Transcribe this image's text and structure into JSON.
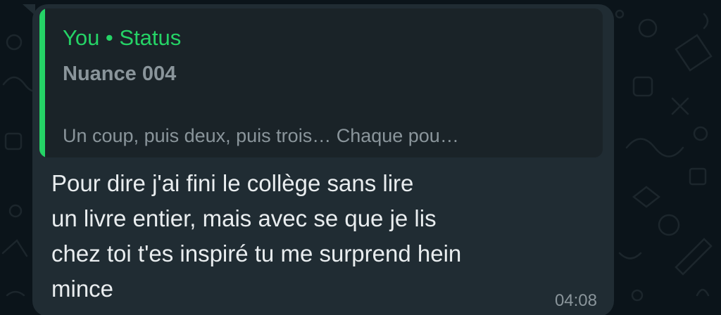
{
  "colors": {
    "background": "#0b141a",
    "bubble": "#202c33",
    "quote_background": "#1a2328",
    "accent": "#25d366",
    "text_primary": "#e9edef",
    "text_secondary": "#8a959b"
  },
  "quote": {
    "author": "You • Status",
    "title": "Nuance 004",
    "snippet": "Un coup, puis deux, puis trois… Chaque pou…"
  },
  "message": {
    "lines": [
      "Pour dire j'ai fini le collège sans lire",
      "un livre entier, mais avec se que je lis",
      "chez toi t'es inspiré tu me surprend hein",
      "mince"
    ],
    "time": "04:08"
  }
}
